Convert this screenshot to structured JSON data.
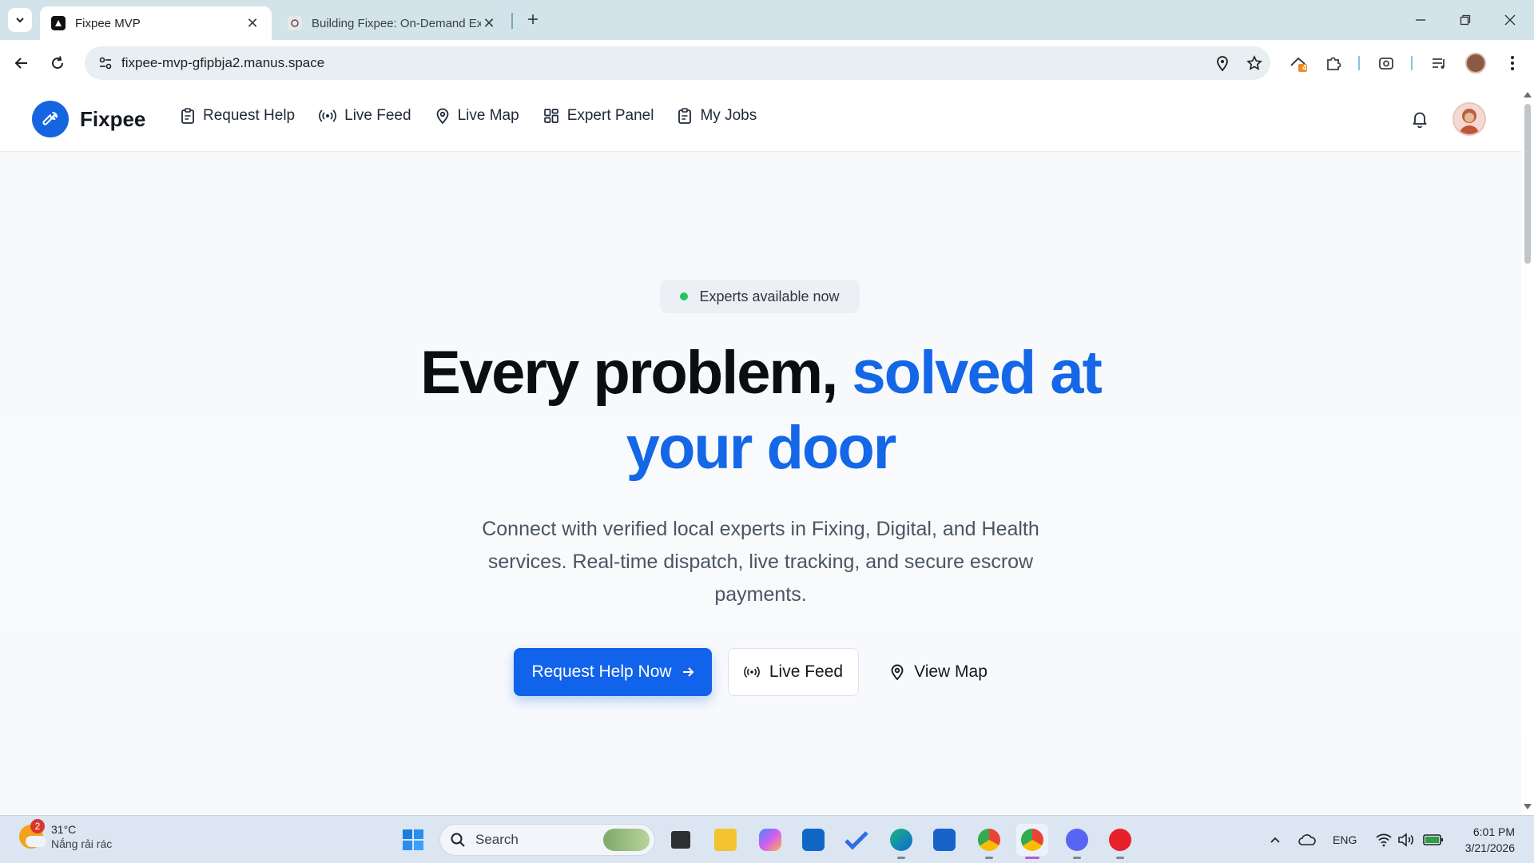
{
  "browser": {
    "tabs": [
      {
        "title": "Fixpee MVP",
        "active": true
      },
      {
        "title": "Building Fixpee: On-Demand Ex",
        "active": false
      }
    ],
    "url": "fixpee-mvp-gfipbja2.manus.space",
    "extension_badge": "4"
  },
  "app": {
    "brand": "Fixpee",
    "nav": [
      {
        "label": "Request Help",
        "icon": "clipboard-icon"
      },
      {
        "label": "Live Feed",
        "icon": "broadcast-icon"
      },
      {
        "label": "Live Map",
        "icon": "map-pin-icon"
      },
      {
        "label": "Expert Panel",
        "icon": "grid-icon"
      },
      {
        "label": "My Jobs",
        "icon": "clipboard-icon"
      }
    ]
  },
  "hero": {
    "badge": "Experts available now",
    "headline_plain": "Every problem, ",
    "headline_accent": "solved at your door",
    "subtitle": "Connect with verified local experts in Fixing, Digital, and Health services. Real-time dispatch, live tracking, and secure escrow payments.",
    "cta_primary": "Request Help Now",
    "cta_secondary": "Live Feed",
    "cta_tertiary": "View Map"
  },
  "colors": {
    "accent": "#1467e6",
    "primary_button": "#1063ea",
    "status_dot": "#22c55e"
  },
  "taskbar": {
    "weather_temp": "31°C",
    "weather_condition": "Nắng rải rác",
    "weather_badge": "2",
    "search_placeholder": "Search",
    "language": "ENG",
    "time": "6:01 PM",
    "date": "3/21/2026"
  }
}
